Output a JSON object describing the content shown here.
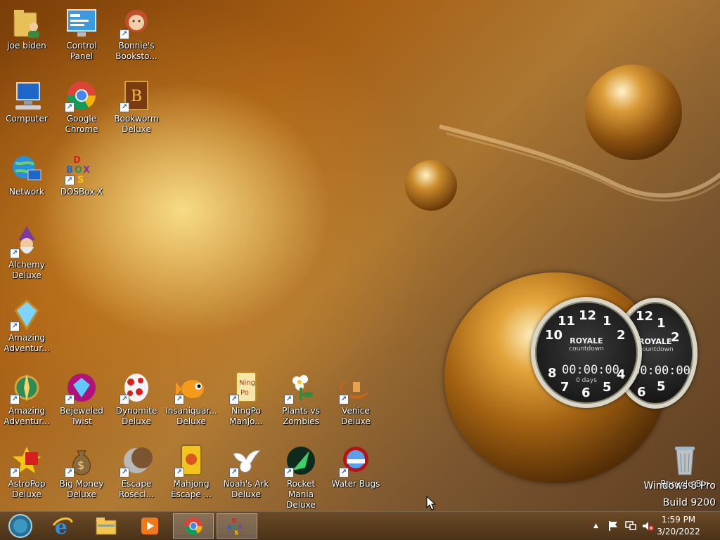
{
  "desktop": {
    "icons": [
      {
        "id": "joe-biden",
        "label": "joe biden",
        "icon": "user-folder-icon"
      },
      {
        "id": "control-panel",
        "label": "Control Panel",
        "icon": "control-panel-icon"
      },
      {
        "id": "bonnies-bookstore",
        "label": "Bonnie's Booksto...",
        "icon": "bonnie-icon"
      },
      {
        "id": "computer",
        "label": "Computer",
        "icon": "computer-icon"
      },
      {
        "id": "google-chrome",
        "label": "Google Chrome",
        "icon": "chrome-icon"
      },
      {
        "id": "bookworm-deluxe",
        "label": "Bookworm Deluxe",
        "icon": "bookworm-icon"
      },
      {
        "id": "network",
        "label": "Network",
        "icon": "network-icon"
      },
      {
        "id": "dosbox-x",
        "label": "DOSBox-X",
        "icon": "dosbox-icon"
      },
      {
        "id": "alchemy-deluxe",
        "label": "Alchemy Deluxe",
        "icon": "wizard-icon"
      },
      {
        "id": "amazing-adventures-1",
        "label": "Amazing Adventur...",
        "icon": "diamond-icon"
      },
      {
        "id": "amazing-adventures-2",
        "label": "Amazing Adventur...",
        "icon": "compass-icon"
      },
      {
        "id": "bejeweled-twist",
        "label": "Bejeweled Twist",
        "icon": "gem-icon"
      },
      {
        "id": "dynomite-deluxe",
        "label": "Dynomite Deluxe",
        "icon": "egg-icon"
      },
      {
        "id": "insaniquarium-deluxe",
        "label": "Insaniquar... Deluxe",
        "icon": "fish-icon"
      },
      {
        "id": "ningpo-mahjong",
        "label": "NingPo MahJo...",
        "icon": "mahjong-tile-icon"
      },
      {
        "id": "plants-vs-zombies",
        "label": "Plants vs Zombies",
        "icon": "flower-icon"
      },
      {
        "id": "venice-deluxe",
        "label": "Venice Deluxe",
        "icon": "gondola-icon"
      },
      {
        "id": "astropop-deluxe",
        "label": "AstroPop Deluxe",
        "icon": "astropop-icon"
      },
      {
        "id": "big-money-deluxe",
        "label": "Big Money Deluxe",
        "icon": "money-bag-icon"
      },
      {
        "id": "escape-rosecliff",
        "label": "Escape Rosecl...",
        "icon": "moon-icon"
      },
      {
        "id": "mahjong-escape",
        "label": "Mahjong Escape ...",
        "icon": "mahjong-escape-icon"
      },
      {
        "id": "noahs-ark-deluxe",
        "label": "Noah's Ark Deluxe",
        "icon": "dove-icon"
      },
      {
        "id": "rocket-mania-deluxe",
        "label": "Rocket Mania Deluxe",
        "icon": "rocket-icon"
      },
      {
        "id": "water-bugs",
        "label": "Water Bugs",
        "icon": "water-bugs-icon"
      },
      {
        "id": "recycle-bin",
        "label": "Recycle Bin",
        "icon": "recycle-bin-icon"
      }
    ],
    "gadget": {
      "brand": "ROYALE",
      "subtitle": "countdown",
      "time": "00:00:00",
      "days": "0 days",
      "dial_numbers": [
        "12",
        "1",
        "2",
        "4",
        "5",
        "6",
        "7",
        "8",
        "10",
        "11"
      ]
    },
    "watermark": {
      "line1": "Windows 8 Pro",
      "line2": "Build 9200"
    }
  },
  "taskbar": {
    "buttons": [
      {
        "id": "start",
        "icon": "start-orb-icon"
      },
      {
        "id": "internet-explorer",
        "icon": "internet-explorer-icon"
      },
      {
        "id": "file-explorer",
        "icon": "file-explorer-icon"
      },
      {
        "id": "media-player",
        "icon": "media-player-icon"
      },
      {
        "id": "chrome",
        "icon": "chrome-icon"
      },
      {
        "id": "dosbox",
        "icon": "dosbox-icon"
      }
    ],
    "tray": {
      "icons": [
        "show-hidden-icons-icon",
        "action-center-flag-icon",
        "network-icon",
        "volume-muted-icon"
      ],
      "expand_glyph": "▲"
    },
    "clock": {
      "time": "1:59 PM",
      "date": "3/20/2022"
    }
  }
}
